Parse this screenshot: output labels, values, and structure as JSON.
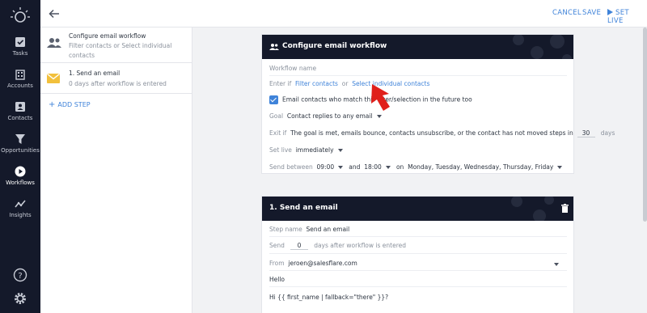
{
  "sidebar": {
    "items": [
      {
        "label": "Tasks",
        "icon": "tasks-icon"
      },
      {
        "label": "Accounts",
        "icon": "accounts-icon"
      },
      {
        "label": "Contacts",
        "icon": "contacts-icon"
      },
      {
        "label": "Opportunities",
        "icon": "funnel-icon"
      },
      {
        "label": "Workflows",
        "icon": "play-icon",
        "active": true
      },
      {
        "label": "Insights",
        "icon": "insights-icon"
      }
    ]
  },
  "topbar": {
    "cancel": "CANCEL",
    "save": "SAVE",
    "set_live": "SET LIVE"
  },
  "steps_panel": {
    "configure": {
      "title": "Configure email workflow",
      "subtitle": "Filter contacts or Select individual contacts"
    },
    "email_step": {
      "title": "1. Send an email",
      "subtitle": "0 days after workflow is entered"
    },
    "add_step": "ADD STEP"
  },
  "configure_card": {
    "title": "Configure email workflow",
    "name_placeholder": "Workflow name",
    "enter_if_label": "Enter if",
    "filter_link": "Filter contacts",
    "or": "or",
    "select_link": "Select individual contacts",
    "match_check_label": "Email contacts who match this filter/selection in the future too",
    "goal_label": "Goal",
    "goal_value": "Contact replies to any email",
    "exit_label": "Exit if",
    "exit_text": "The goal is met, emails bounce, contacts unsubscribe, or the contact has not moved steps in",
    "exit_days_value": "30",
    "exit_days_unit": "days",
    "setlive_label": "Set live",
    "setlive_value": "immediately",
    "send_between_label": "Send between",
    "from_time": "09:00",
    "and": "and",
    "to_time": "18:00",
    "on": "on",
    "days_value": "Monday, Tuesday, Wednesday, Thursday, Friday"
  },
  "email_card": {
    "title": "1. Send an email",
    "step_name_label": "Step name",
    "step_name_value": "Send an email",
    "send_label": "Send",
    "send_days": "0",
    "send_after": "days after workflow is entered",
    "from_label": "From",
    "from_value": "jeroen@salesflare.com",
    "body_line1": "Hello",
    "body_line2": "Hi {{ first_name | fallback=\"there\" }}?"
  },
  "colors": {
    "sidebar": "#14192a",
    "accent": "#3f83d9",
    "arrow": "#e0201b"
  }
}
